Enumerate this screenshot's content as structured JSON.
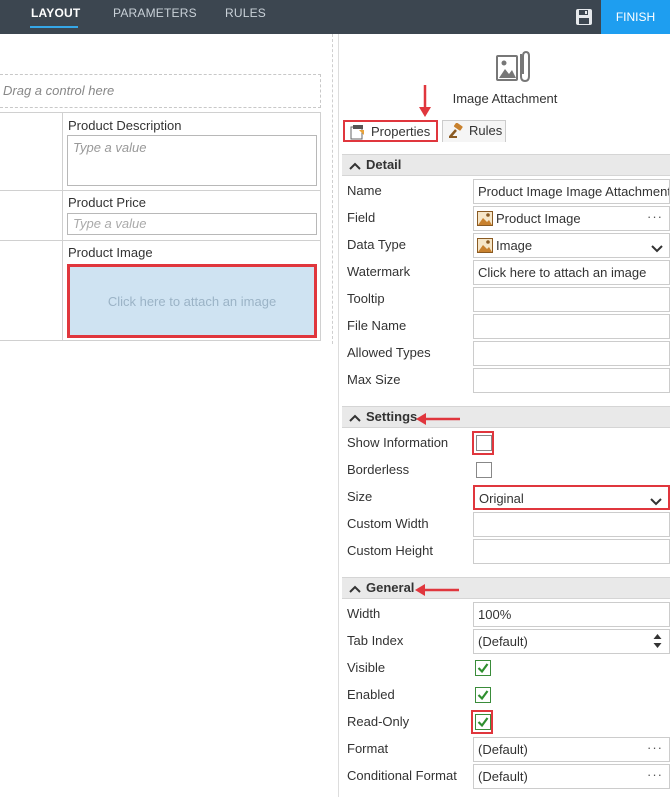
{
  "topbar": {
    "tabs": [
      "LAYOUT",
      "PARAMETERS",
      "RULES"
    ],
    "active_tab": "LAYOUT",
    "save_icon": "save-icon",
    "finish_label": "FINISH",
    "accent_color": "#1e9ef0"
  },
  "canvas": {
    "drop_zone_text": "Drag a control here",
    "fields": [
      {
        "label": "Product Description",
        "placeholder": "Type a value"
      },
      {
        "label": "Product Price",
        "placeholder": "Type a value"
      },
      {
        "label": "Product Image",
        "attach_text": "Click here to attach an image"
      }
    ]
  },
  "panel": {
    "control_icon": "image-attachment-icon",
    "control_title": "Image Attachment",
    "tabs": [
      "Properties",
      "Rules"
    ],
    "active_tab": "Properties",
    "sections": {
      "detail": {
        "title": "Detail",
        "rows": [
          {
            "label": "Name",
            "value": "Product Image Image Attachment"
          },
          {
            "label": "Field",
            "value": "Product Image"
          },
          {
            "label": "Data Type",
            "value": "Image"
          },
          {
            "label": "Watermark",
            "value": "Click here to attach an image"
          },
          {
            "label": "Tooltip",
            "value": ""
          },
          {
            "label": "File Name",
            "value": ""
          },
          {
            "label": "Allowed Types",
            "value": ""
          },
          {
            "label": "Max Size",
            "value": ""
          }
        ]
      },
      "settings": {
        "title": "Settings",
        "rows": [
          {
            "label": "Show Information",
            "checked": false
          },
          {
            "label": "Borderless",
            "checked": false
          },
          {
            "label": "Size",
            "value": "Original"
          },
          {
            "label": "Custom Width",
            "value": ""
          },
          {
            "label": "Custom Height",
            "value": ""
          }
        ]
      },
      "general": {
        "title": "General",
        "rows": [
          {
            "label": "Width",
            "value": "100%"
          },
          {
            "label": "Tab Index",
            "value": "(Default)"
          },
          {
            "label": "Visible",
            "checked": true
          },
          {
            "label": "Enabled",
            "checked": true
          },
          {
            "label": "Read-Only",
            "checked": true
          },
          {
            "label": "Format",
            "value": "(Default)"
          },
          {
            "label": "Conditional Format",
            "value": "(Default)"
          }
        ]
      }
    },
    "highlight_color": "#e0363d"
  }
}
